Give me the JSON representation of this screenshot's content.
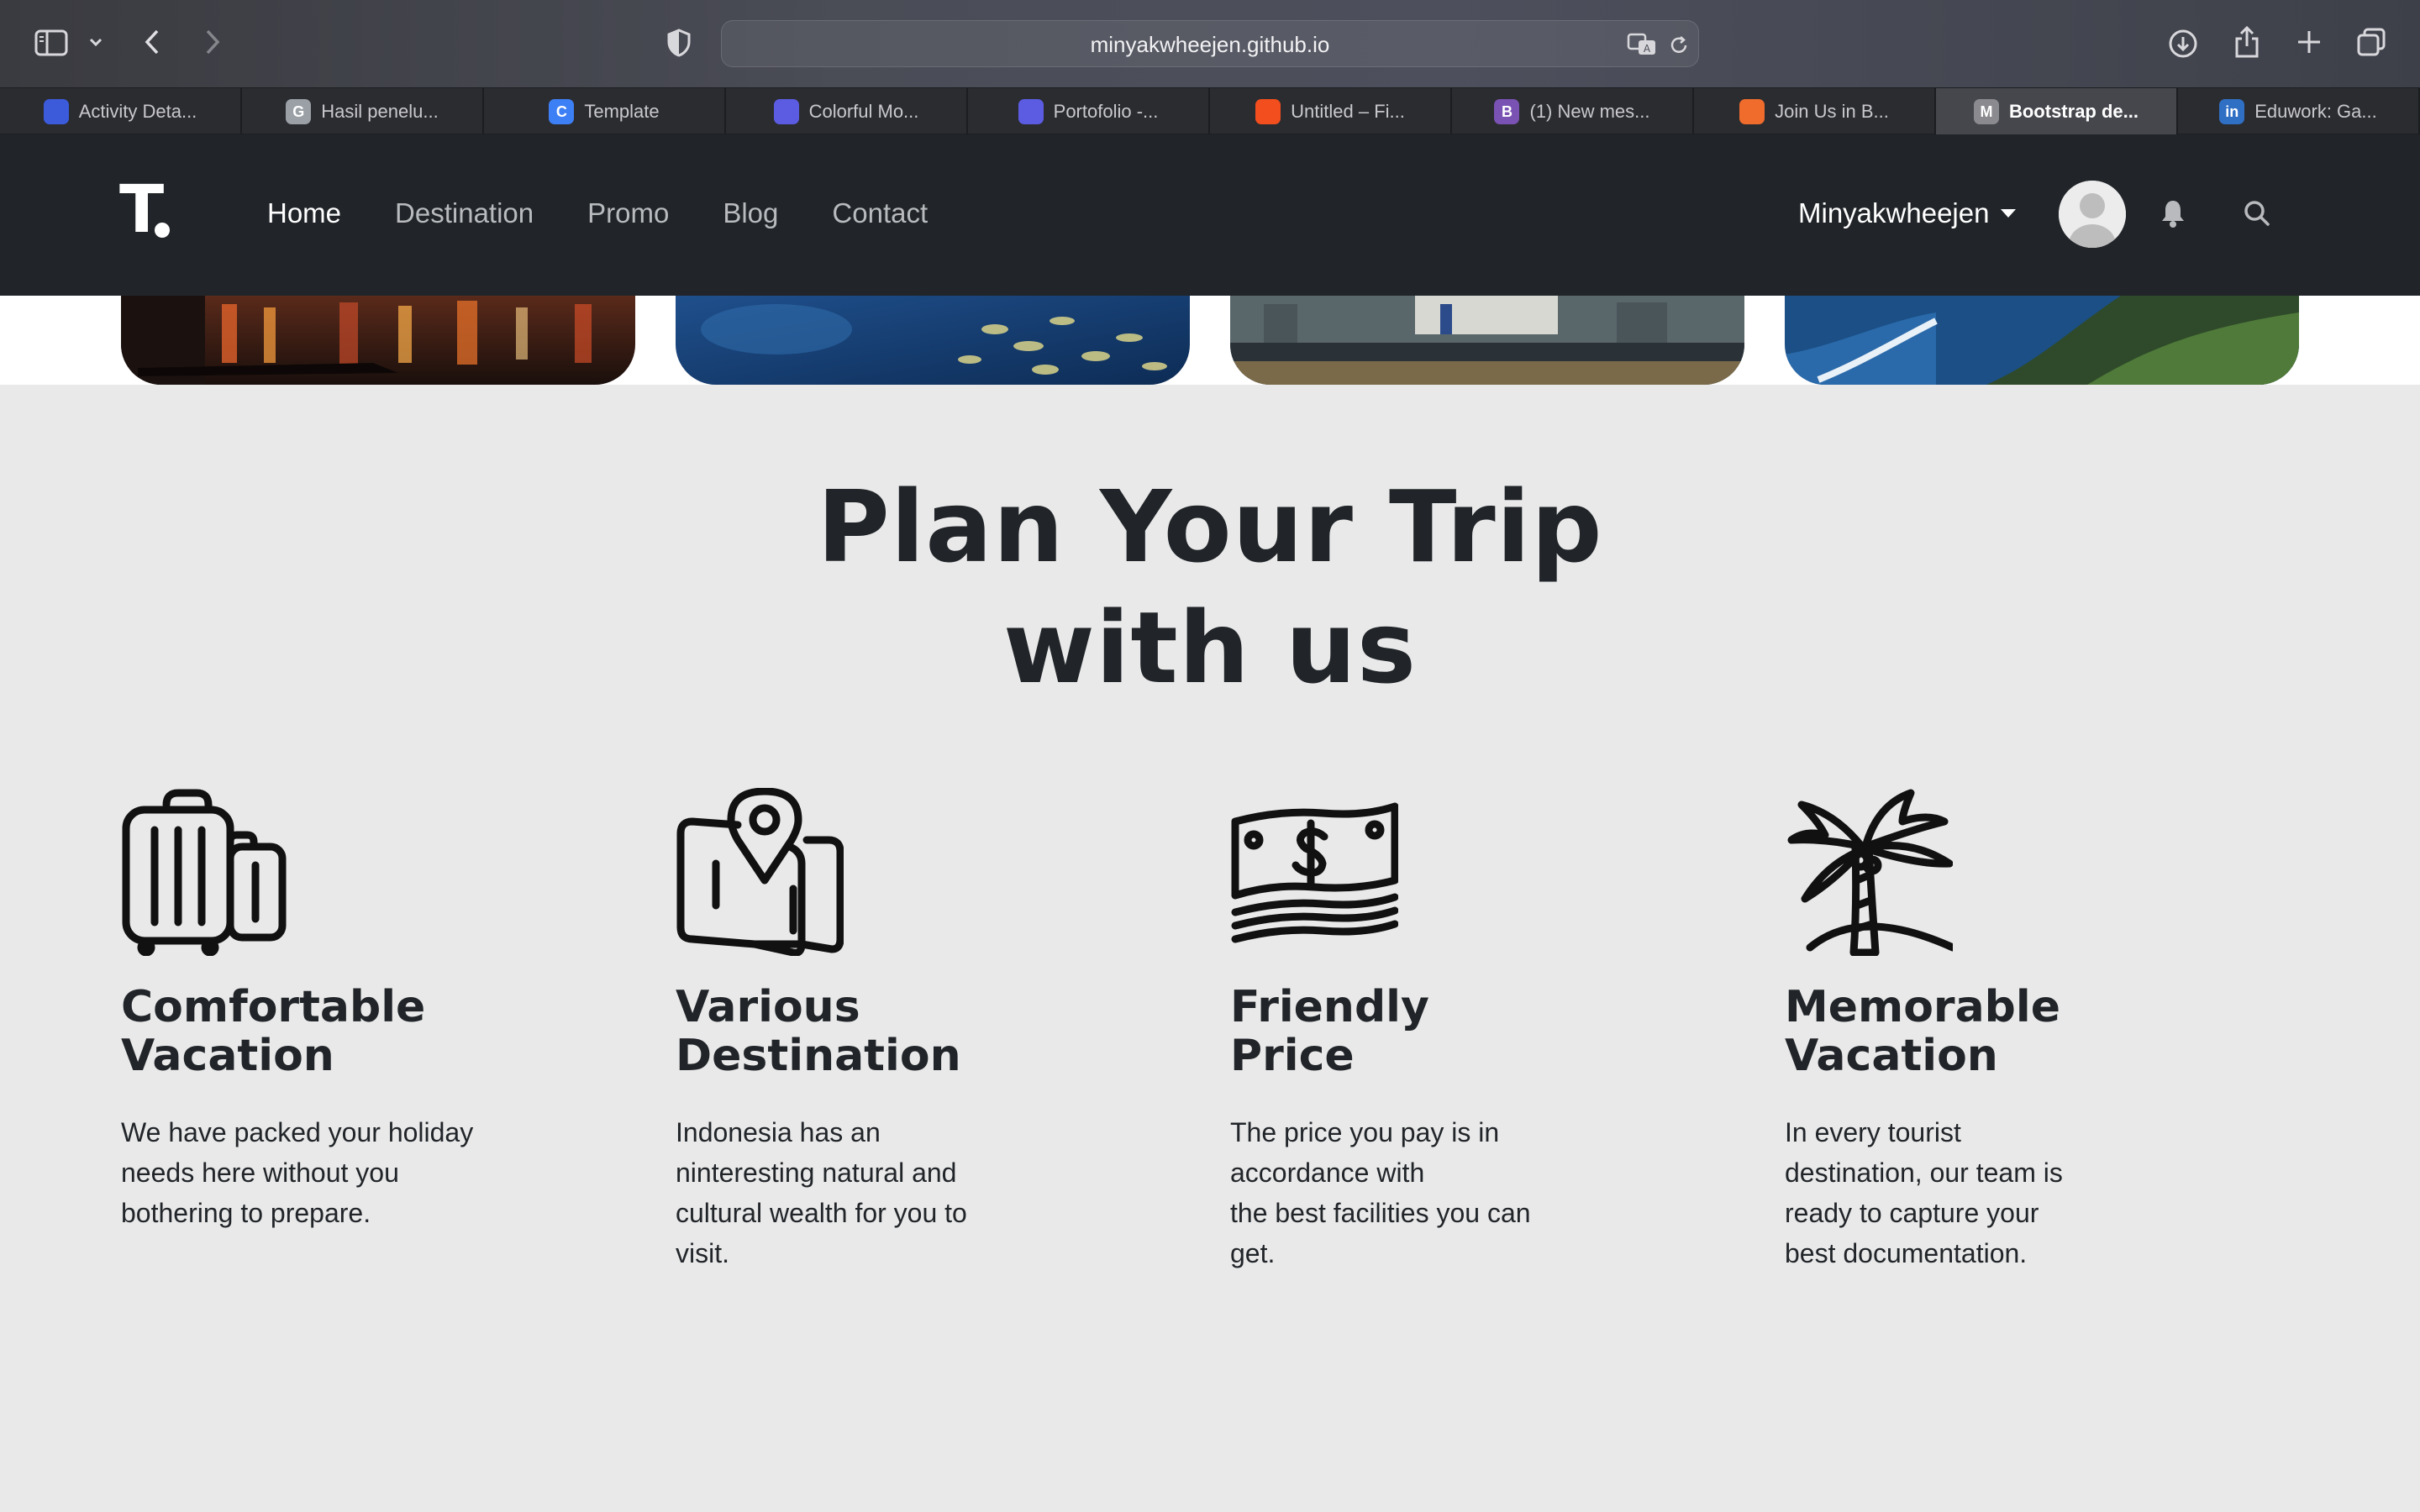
{
  "browser": {
    "url": "minyakwheejen.github.io",
    "tabs": [
      {
        "label": "Activity Deta...",
        "icon": "activity-favicon",
        "color": "#3b5bdb",
        "letter": "",
        "active": false
      },
      {
        "label": "Hasil penelu...",
        "icon": "google-favicon",
        "color": "#9aa0a6",
        "letter": "G",
        "active": false
      },
      {
        "label": "Template",
        "icon": "canva-favicon",
        "color": "#3d7ff5",
        "letter": "C",
        "active": false
      },
      {
        "label": "Colorful Mo...",
        "icon": "slides-favicon",
        "color": "#5b5ce2",
        "letter": "",
        "active": false
      },
      {
        "label": "Portofolio -...",
        "icon": "slides-favicon",
        "color": "#5b5ce2",
        "letter": "",
        "active": false
      },
      {
        "label": "Untitled – Fi...",
        "icon": "figma-favicon",
        "color": "#f24e1e",
        "letter": "",
        "active": false
      },
      {
        "label": "(1) New mes...",
        "icon": "bootstrap-favicon",
        "color": "#7952b3",
        "letter": "B",
        "active": false
      },
      {
        "label": "Join Us in B...",
        "icon": "fox-favicon",
        "color": "#ef6c2c",
        "letter": "",
        "active": false
      },
      {
        "label": "Bootstrap de...",
        "icon": "medium-favicon",
        "color": "#8a8a8f",
        "letter": "M",
        "active": true
      },
      {
        "label": "Eduwork: Ga...",
        "icon": "linkedin-favicon",
        "color": "#2f6fc4",
        "letter": "in",
        "active": false
      }
    ]
  },
  "site": {
    "brand": "T",
    "nav": [
      {
        "label": "Home",
        "active": true
      },
      {
        "label": "Destination",
        "active": false
      },
      {
        "label": "Promo",
        "active": false
      },
      {
        "label": "Blog",
        "active": false
      },
      {
        "label": "Contact",
        "active": false
      }
    ],
    "user": "Minyakwheejen"
  },
  "section": {
    "heading_line1": "Plan Your Trip",
    "heading_line2": "with us",
    "features": [
      {
        "icon": "luggage-icon",
        "title_line1": "Comfortable",
        "title_line2": "Vacation",
        "desc": [
          "We have packed your holiday",
          "needs here without you",
          "bothering to prepare."
        ]
      },
      {
        "icon": "map-pin-icon",
        "title_line1": "Various",
        "title_line2": "Destination",
        "desc": [
          "Indonesia has an",
          "ninteresting natural and",
          "cultural wealth for you to",
          "visit."
        ]
      },
      {
        "icon": "money-icon",
        "title_line1": "Friendly",
        "title_line2": "Price",
        "desc": [
          "The price you pay is in",
          "accordance with",
          "the best facilities you can",
          "get."
        ]
      },
      {
        "icon": "palm-tree-icon",
        "title_line1": "Memorable",
        "title_line2": "Vacation",
        "desc": [
          "In every tourist",
          "destination, our team is",
          "ready to capture your",
          "best documentation."
        ]
      }
    ]
  },
  "colors": {
    "navbar": "#212529",
    "section_bg": "#e9e9e9",
    "text": "#212529"
  }
}
